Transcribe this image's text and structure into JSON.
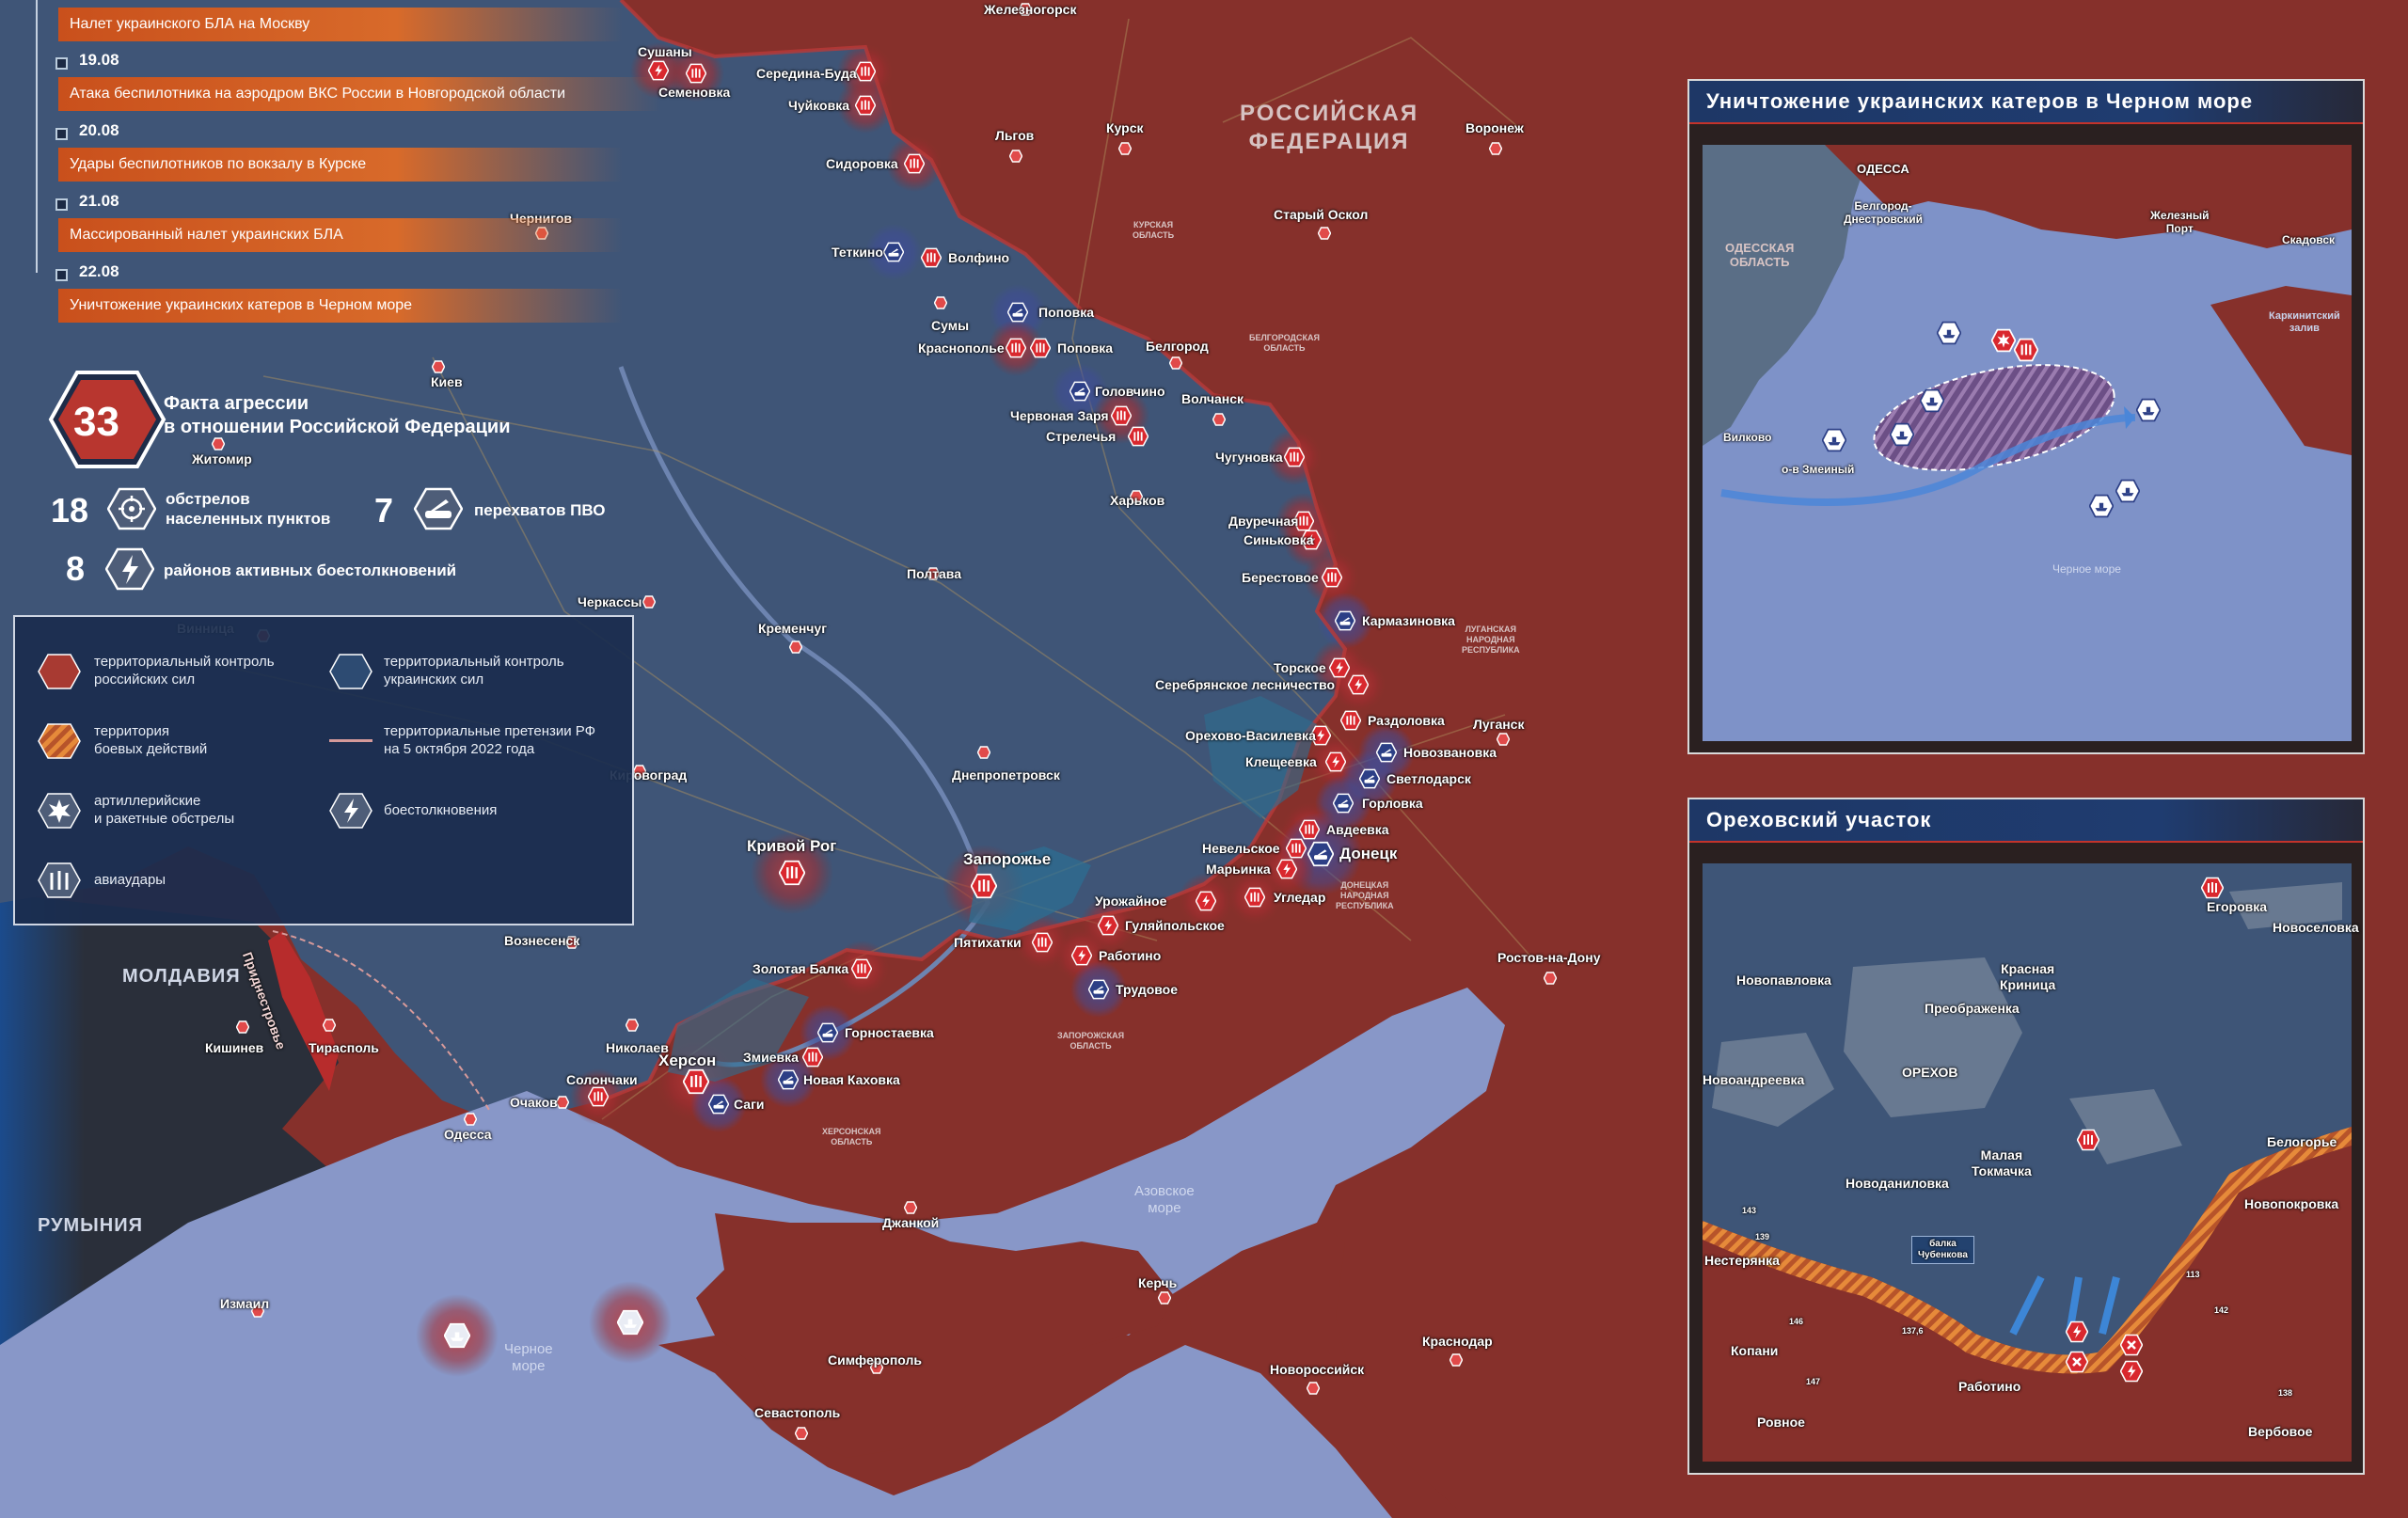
{
  "colors": {
    "russian_control": "#8a2e2a",
    "ukrainian_control": "#3b4f73",
    "sea": "#8597c6",
    "combat": "#e07a2e",
    "red_marker": "#d9282e",
    "blue_marker": "#2c3f86"
  },
  "timeline": [
    {
      "date": "",
      "text": "Налет украинского БЛА на Москву"
    },
    {
      "date": "19.08",
      "text": "Атака беспилотника на аэродром ВКС России в Новгородской области"
    },
    {
      "date": "20.08",
      "text": "Удары беспилотников по вокзалу в Курске"
    },
    {
      "date": "21.08",
      "text": "Массированный налет украинских БЛА"
    },
    {
      "date": "22.08",
      "text": "Уничтожение украинских катеров в Черном море"
    }
  ],
  "stats": {
    "total": "33",
    "total_label_1": "Факта агрессии",
    "total_label_2": "в отношении Российской Федерации",
    "shelling_count": "18",
    "shelling_label_1": "обстрелов",
    "shelling_label_2": "населенных пунктов",
    "pvo_count": "7",
    "pvo_label": "перехватов ПВО",
    "clash_count": "8",
    "clash_label": "районов активных боестолкновений"
  },
  "legend": {
    "russian_1": "территориальный контроль",
    "russian_2": "российских сил",
    "ukrainian_1": "территориальный контроль",
    "ukrainian_2": "украинских сил",
    "combat_1": "территория",
    "combat_2": "боевых действий",
    "claims_1": "территориальные претензии РФ",
    "claims_2": "на 5 октября 2022 года",
    "artillery_1": "артиллерийские",
    "artillery_2": "и ракетные обстрелы",
    "clashes": "боестолкновения",
    "airstrikes": "авиаудары"
  },
  "map_labels": {
    "russia_1": "РОССИЙСКАЯ",
    "russia_2": "ФЕДЕРАЦИЯ",
    "moldova": "МОЛДАВИЯ",
    "romania": "РУМЫНИЯ",
    "pridnestrovie": "Приднестровье",
    "azov_1": "Азовское",
    "azov_2": "море",
    "black_1": "Черное",
    "black_2": "море",
    "kursk_obl_1": "КУРСКАЯ",
    "kursk_obl_2": "ОБЛАСТЬ",
    "belgorod_obl_1": "БЕЛГОРОДСКАЯ",
    "belgorod_obl_2": "ОБЛАСТЬ",
    "lugansk_obl_1": "ЛУГАНСКАЯ",
    "lugansk_obl_2": "НАРОДНАЯ",
    "lugansk_obl_3": "РЕСПУБЛИКА",
    "donetsk_obl_1": "ДОНЕЦКАЯ",
    "donetsk_obl_2": "НАРОДНАЯ",
    "donetsk_obl_3": "РЕСПУБЛИКА",
    "zap_obl_1": "ЗАПОРОЖСКАЯ",
    "zap_obl_2": "ОБЛАСТЬ",
    "kherson_obl_1": "ХЕРСОНСКАЯ",
    "kherson_obl_2": "ОБЛАСТЬ"
  },
  "cities": {
    "zheleznogorsk": "Железногорск",
    "sushany": "Сушаны",
    "semenovka": "Семеновка",
    "seredina_buda": "Середина-Буда",
    "chuykovka": "Чуйковка",
    "sidorovka": "Сидоровка",
    "lgov": "Льгов",
    "kursk": "Курск",
    "voronezh": "Воронеж",
    "stary_oskol": "Старый Оскол",
    "chernigov": "Чернигов",
    "tetkino": "Теткино",
    "volfino": "Волфино",
    "sumy": "Сумы",
    "popovka": "Поповка",
    "krasnopole": "Краснополье",
    "popovka2": "Поповка",
    "belgorod": "Белгород",
    "kiev": "Киев",
    "zhitomir": "Житомир",
    "golovchino": "Головчино",
    "chervonaya_zarya": "Червоная Заря",
    "strelechya": "Стрелечья",
    "volchansk": "Волчанск",
    "chugunovka": "Чугуновка",
    "kharkov": "Харьков",
    "dvurechnaya": "Двуречная",
    "sinkovka": "Синьковка",
    "berestovoe": "Берестовое",
    "poltava": "Полтава",
    "cherkassy": "Черкассы",
    "vinnitsa": "Винница",
    "kremenchug": "Кременчуг",
    "karmazinovka": "Кармазиновка",
    "torskoe": "Торское",
    "serebryanskoe": "Серебрянское лесничество",
    "razdolovka": "Раздоловка",
    "lugansk": "Луганск",
    "orekhovo_vasilevka": "Орехово-Василевка",
    "novozvanovka": "Новозвановка",
    "kleshcheevka": "Клещеевка",
    "svetlodarsk": "Светлодарск",
    "gorlovka": "Горловка",
    "kirovograd": "Кировоград",
    "dnepropetrovsk": "Днепропетровск",
    "avdeevka": "Авдеевка",
    "nevelskoe": "Невельское",
    "donetsk": "Донецк",
    "marinka": "Марьинка",
    "krivoy_rog": "Кривой Рог",
    "zaporozhye": "Запорожье",
    "urozhaynoe": "Урожайное",
    "ugledar": "Угледар",
    "gulyaypolskoe": "Гуляйпольское",
    "pyatikhatki": "Пятихатки",
    "rabotino": "Работино",
    "voznesensk": "Вознесенск",
    "zolotaya_balka": "Золотая Балка",
    "trudovoe": "Трудовое",
    "rostov": "Ростов-на-Дону",
    "gornostaevka": "Горностаевка",
    "nikolaev": "Николаев",
    "kishinev": "Кишинев",
    "tiraspol": "Тирасполь",
    "kherson": "Херсон",
    "solonchaki": "Солончаки",
    "zmievka": "Змиевка",
    "novaya_kakhovka": "Новая Каховка",
    "ochakov": "Очаков",
    "sagi": "Саги",
    "odessa": "Одесса",
    "dzhankoy": "Джанкой",
    "kerch": "Керчь",
    "izmail": "Измаил",
    "krasnodar": "Краснодар",
    "simferopol": "Симферополь",
    "novorossiysk": "Новороссийск",
    "sevastopol": "Севастополь"
  },
  "inset_sea": {
    "title": "Уничтожение украинских катеров в Черном море",
    "odessa": "ОДЕССА",
    "belgorod_dnestr_1": "Белгород-",
    "belgorod_dnestr_2": "Днестровский",
    "odessa_obl_1": "ОДЕССКАЯ",
    "odessa_obl_2": "ОБЛАСТЬ",
    "zhelezny_port_1": "Железный",
    "zhelezny_port_2": "Порт",
    "skadovsk": "Скадовск",
    "karkinit_1": "Каркинитский",
    "karkinit_2": "залив",
    "vilkovo": "Вилково",
    "zmeiny": "о-в Змеиный",
    "black_sea": "Черное море"
  },
  "inset_orekhov": {
    "title": "Ореховский участок",
    "egorovka": "Егоровка",
    "novoselovka": "Новоселовка",
    "novopavlovka": "Новопавловка",
    "krasnaya_1": "Красная",
    "krasnaya_2": "Криница",
    "preobrazhenka": "Преображенка",
    "orekhov": "ОРЕХОВ",
    "novoandreevka": "Новоандреевка",
    "malaya_1": "Малая",
    "malaya_2": "Токмачка",
    "belogorye": "Белогорье",
    "novodanilovka": "Новоданиловка",
    "novopokrovka": "Новопокровка",
    "nesteryanka": "Нестерянка",
    "balka_1": "балка",
    "balka_2": "Чубенкова",
    "kopani": "Копани",
    "rabotino": "Работино",
    "rovnoe": "Ровное",
    "verbovoe": "Вербовое",
    "h143": "143",
    "h139": "139",
    "h146": "146",
    "h147": "147",
    "h1376": "137,6",
    "h113": "113",
    "h142": "142",
    "h138": "138"
  }
}
